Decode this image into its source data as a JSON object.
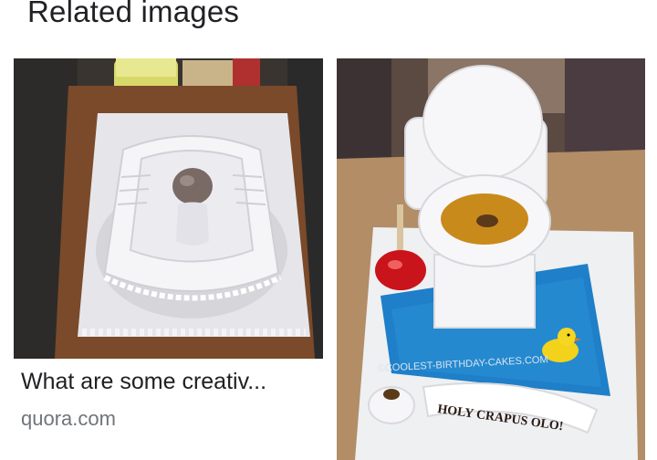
{
  "section": {
    "title": "Related images"
  },
  "results": [
    {
      "caption": "What are some creativ...",
      "source": "quora.com",
      "image_alt": "White squat-toilet shaped cake on a tray"
    },
    {
      "image_alt": "Toilet shaped birthday cake with plunger, duck and toilet paper",
      "watermark": "©COOLEST-BIRTHDAY-CAKES.COM",
      "banner_text": "HOLY CRAPUS OLO!"
    }
  ]
}
